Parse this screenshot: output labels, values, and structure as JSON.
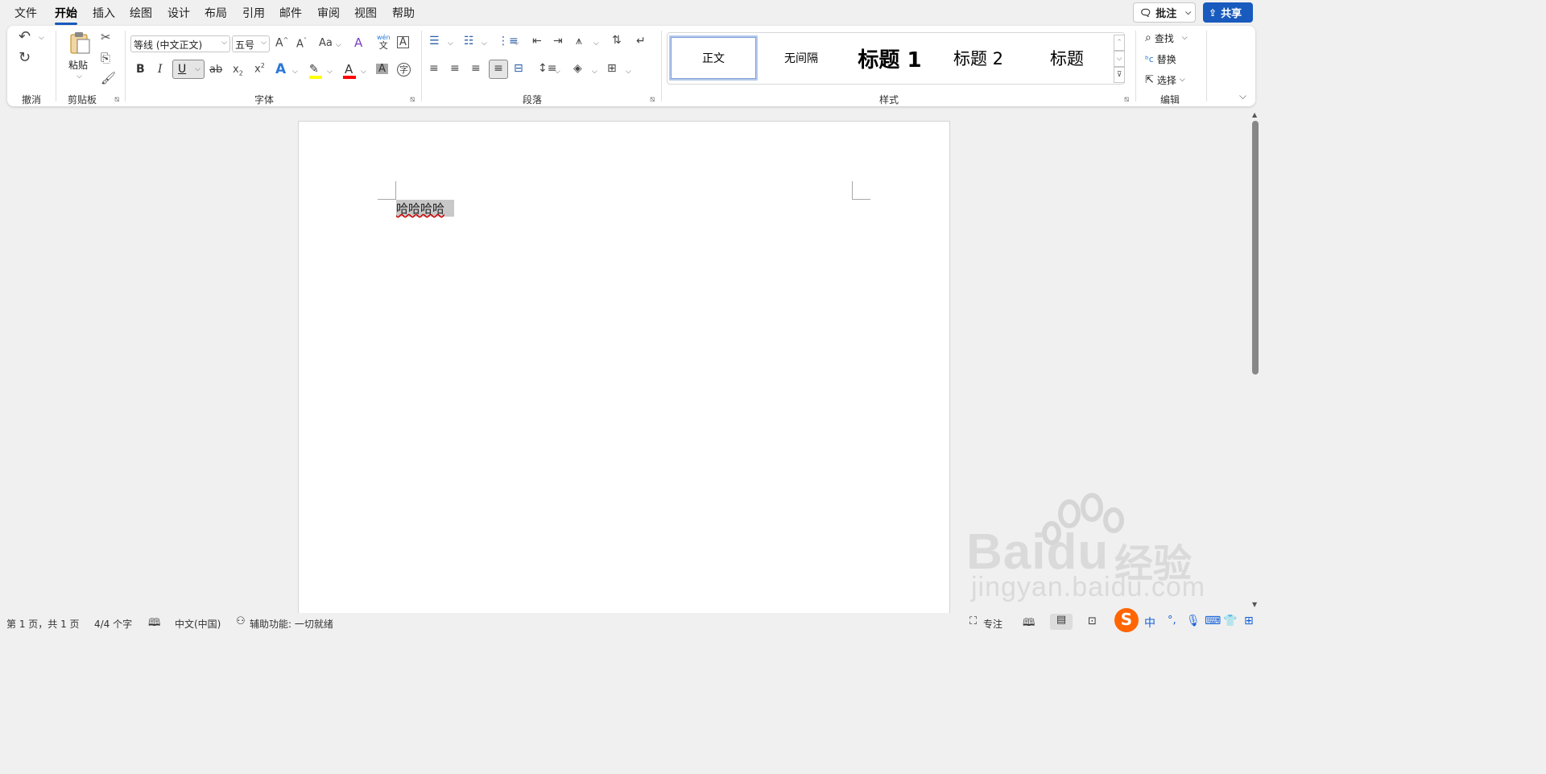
{
  "menu": {
    "items": [
      "文件",
      "开始",
      "插入",
      "绘图",
      "设计",
      "布局",
      "引用",
      "邮件",
      "审阅",
      "视图",
      "帮助"
    ],
    "active": "开始",
    "comment_label": "批注",
    "share_label": "共享"
  },
  "ribbon": {
    "undo_group": {
      "label": "撤消"
    },
    "clipboard_group": {
      "label": "剪贴板",
      "paste_label": "粘贴"
    },
    "font_group": {
      "label": "字体",
      "font_name": "等线 (中文正文)",
      "font_size": "五号",
      "phonetic_label": "wén",
      "phonetic_char": "文",
      "enclose_char": "字",
      "case_label": "Aa",
      "colors": {
        "highlight": "#ffff00",
        "font": "#ff0000",
        "shading": "#a6a6a6"
      }
    },
    "paragraph_group": {
      "label": "段落"
    },
    "styles_group": {
      "label": "样式",
      "styles": [
        "正文",
        "无间隔",
        "标题 1",
        "标题 2",
        "标题"
      ],
      "selected": "正文"
    },
    "editing_group": {
      "label": "编辑",
      "find_label": "查找",
      "replace_label": "替换",
      "select_label": "选择"
    }
  },
  "document": {
    "text": "哈哈哈哈"
  },
  "watermark": {
    "brand": "Baidu",
    "product": "经验",
    "url": "jingyan.baidu.com"
  },
  "statusbar": {
    "page": "第 1 页，共 1 页",
    "words": "4/4 个字",
    "language": "中文(中国)",
    "accessibility": "辅助功能: 一切就绪",
    "focus": "专注",
    "ime": {
      "logo": "S",
      "mode": "中",
      "punct": "°,"
    }
  },
  "colors": {
    "accent": "#185abd",
    "ime_orange": "#ff6600"
  }
}
